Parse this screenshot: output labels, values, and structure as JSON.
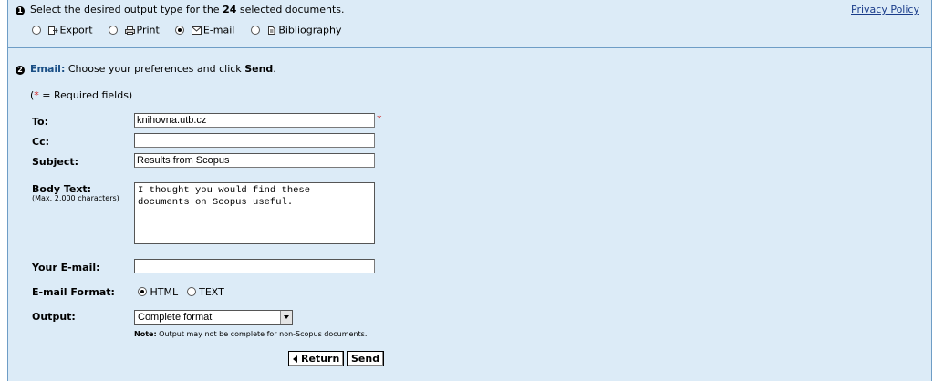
{
  "step1": {
    "number": "1",
    "text_before": "Select the desired output type for the ",
    "count": "24",
    "text_after": " selected documents.",
    "privacy_link": "Privacy Policy",
    "options": [
      {
        "label": "Export",
        "icon": "export-icon",
        "checked": false
      },
      {
        "label": "Print",
        "icon": "print-icon",
        "checked": false
      },
      {
        "label": "E-mail",
        "icon": "mail-icon",
        "checked": true
      },
      {
        "label": "Bibliography",
        "icon": "document-icon",
        "checked": false
      }
    ]
  },
  "step2": {
    "number": "2",
    "heading": "Email:",
    "text": " Choose your preferences and click ",
    "send_word": "Send",
    "period": "."
  },
  "required_note": {
    "open": "(",
    "star": "*",
    "text": " = Required fields)"
  },
  "form": {
    "to": {
      "label": "To:",
      "value": "knihovna.utb.cz",
      "required": "*"
    },
    "cc": {
      "label": "Cc:",
      "value": ""
    },
    "subject": {
      "label": "Subject:",
      "value": "Results from Scopus"
    },
    "body": {
      "label": "Body Text:",
      "hint": "(Max. 2,000 characters)",
      "line1": "I thought you would find these",
      "line2": "documents on Scopus useful."
    },
    "your_email": {
      "label": "Your E-mail:",
      "value": ""
    },
    "format": {
      "label": "E-mail Format:",
      "options": [
        {
          "label": "HTML",
          "checked": true
        },
        {
          "label": "TEXT",
          "checked": false
        }
      ]
    },
    "output": {
      "label": "Output:",
      "selected": "Complete format"
    },
    "note_label": "Note:",
    "note_text": " Output may not be complete for non-Scopus documents."
  },
  "buttons": {
    "return_label": "Return",
    "send_label": "Send"
  },
  "colors": {
    "panel_bg": "#dcebf7",
    "heading_blue": "#1a4f86",
    "required_red": "#d01818"
  }
}
